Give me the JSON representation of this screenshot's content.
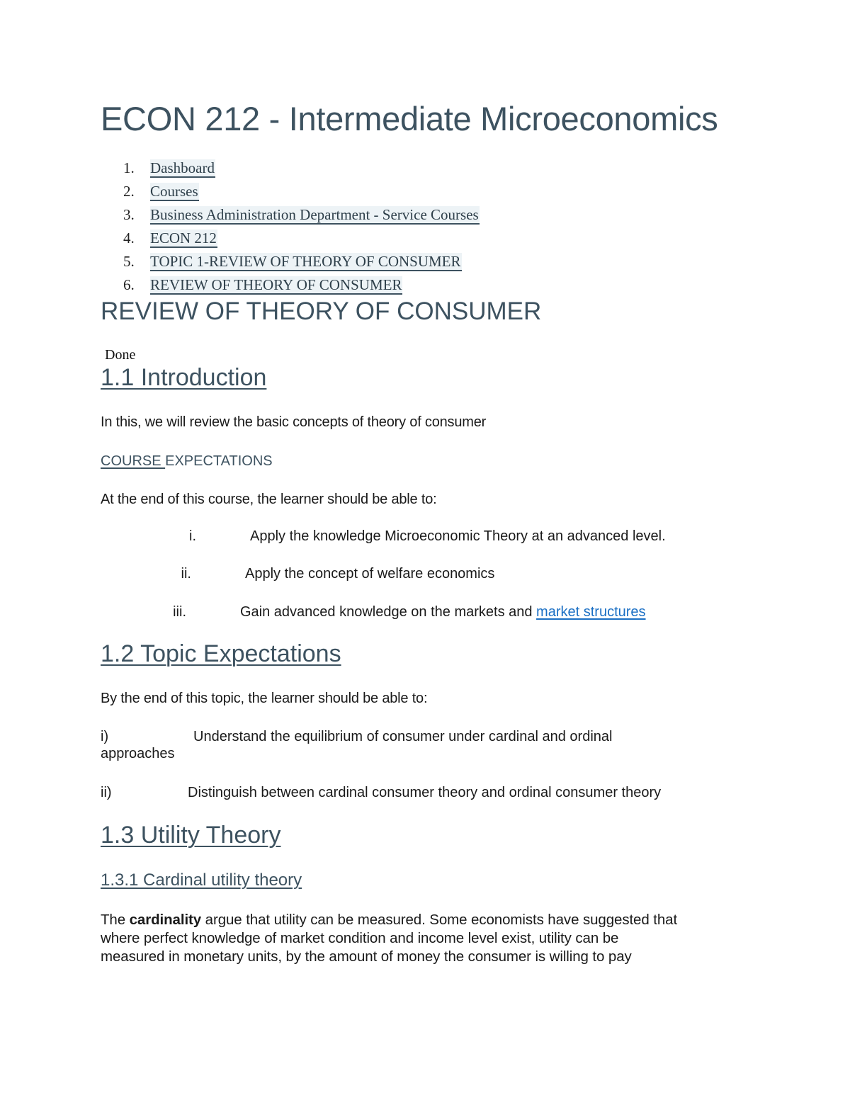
{
  "title": "ECON 212 - Intermediate Microeconomics",
  "breadcrumbs": [
    {
      "num": "1.",
      "label": "Dashboard"
    },
    {
      "num": "2.",
      "label": "Courses"
    },
    {
      "num": "3.",
      "label": "Business Administration Department - Service Courses"
    },
    {
      "num": "4.",
      "label": "ECON 212"
    },
    {
      "num": "5.",
      "label": "TOPIC 1-REVIEW OF THEORY OF CONSUMER"
    },
    {
      "num": "6.",
      "label": "REVIEW OF THEORY OF CONSUMER"
    }
  ],
  "page_heading": "REVIEW OF THEORY OF CONSUMER",
  "status": "Done",
  "sections": {
    "intro": {
      "heading": "1.1 Introduction",
      "text": "In this, we will review the basic concepts of theory of consumer",
      "course_expectations": {
        "underlined": "COURSE ",
        "rest": "EXPECTATIONS"
      },
      "lead": "At the end of this course, the learner should be able to:",
      "items": [
        {
          "num": "i.",
          "text": "Apply the knowledge Microeconomic Theory at an advanced level."
        },
        {
          "num": "ii.",
          "text": "Apply the concept of welfare economics"
        },
        {
          "num": "iii.",
          "text": "Gain advanced knowledge on the markets and ",
          "link": "market structures"
        }
      ]
    },
    "topic": {
      "heading": "1.2 Topic Expectations",
      "lead": "By the end of this topic, the learner should be able to:",
      "items": [
        {
          "num": "i)",
          "text": "Understand the equilibrium of consumer under cardinal and ordinal",
          "continuation": "approaches"
        },
        {
          "num": "ii)",
          "text": "Distinguish between cardinal consumer theory and ordinal consumer theory"
        }
      ]
    },
    "utility": {
      "heading": "1.3 Utility Theory",
      "subheading": "1.3.1 Cardinal utility theory",
      "para_prefix": "The ",
      "para_bold": "cardinality",
      "para_line1_rest": " argue that utility can be measured. Some economists have suggested that",
      "para_line2": "where perfect knowledge of market condition and income level exist, utility can be",
      "para_line3": "measured in monetary units, by the amount of money the consumer is willing to pay"
    }
  },
  "colors": {
    "heading": "#3d5260",
    "link_blue": "#1a6fc4",
    "crumb_highlight": "#edf3f6"
  }
}
